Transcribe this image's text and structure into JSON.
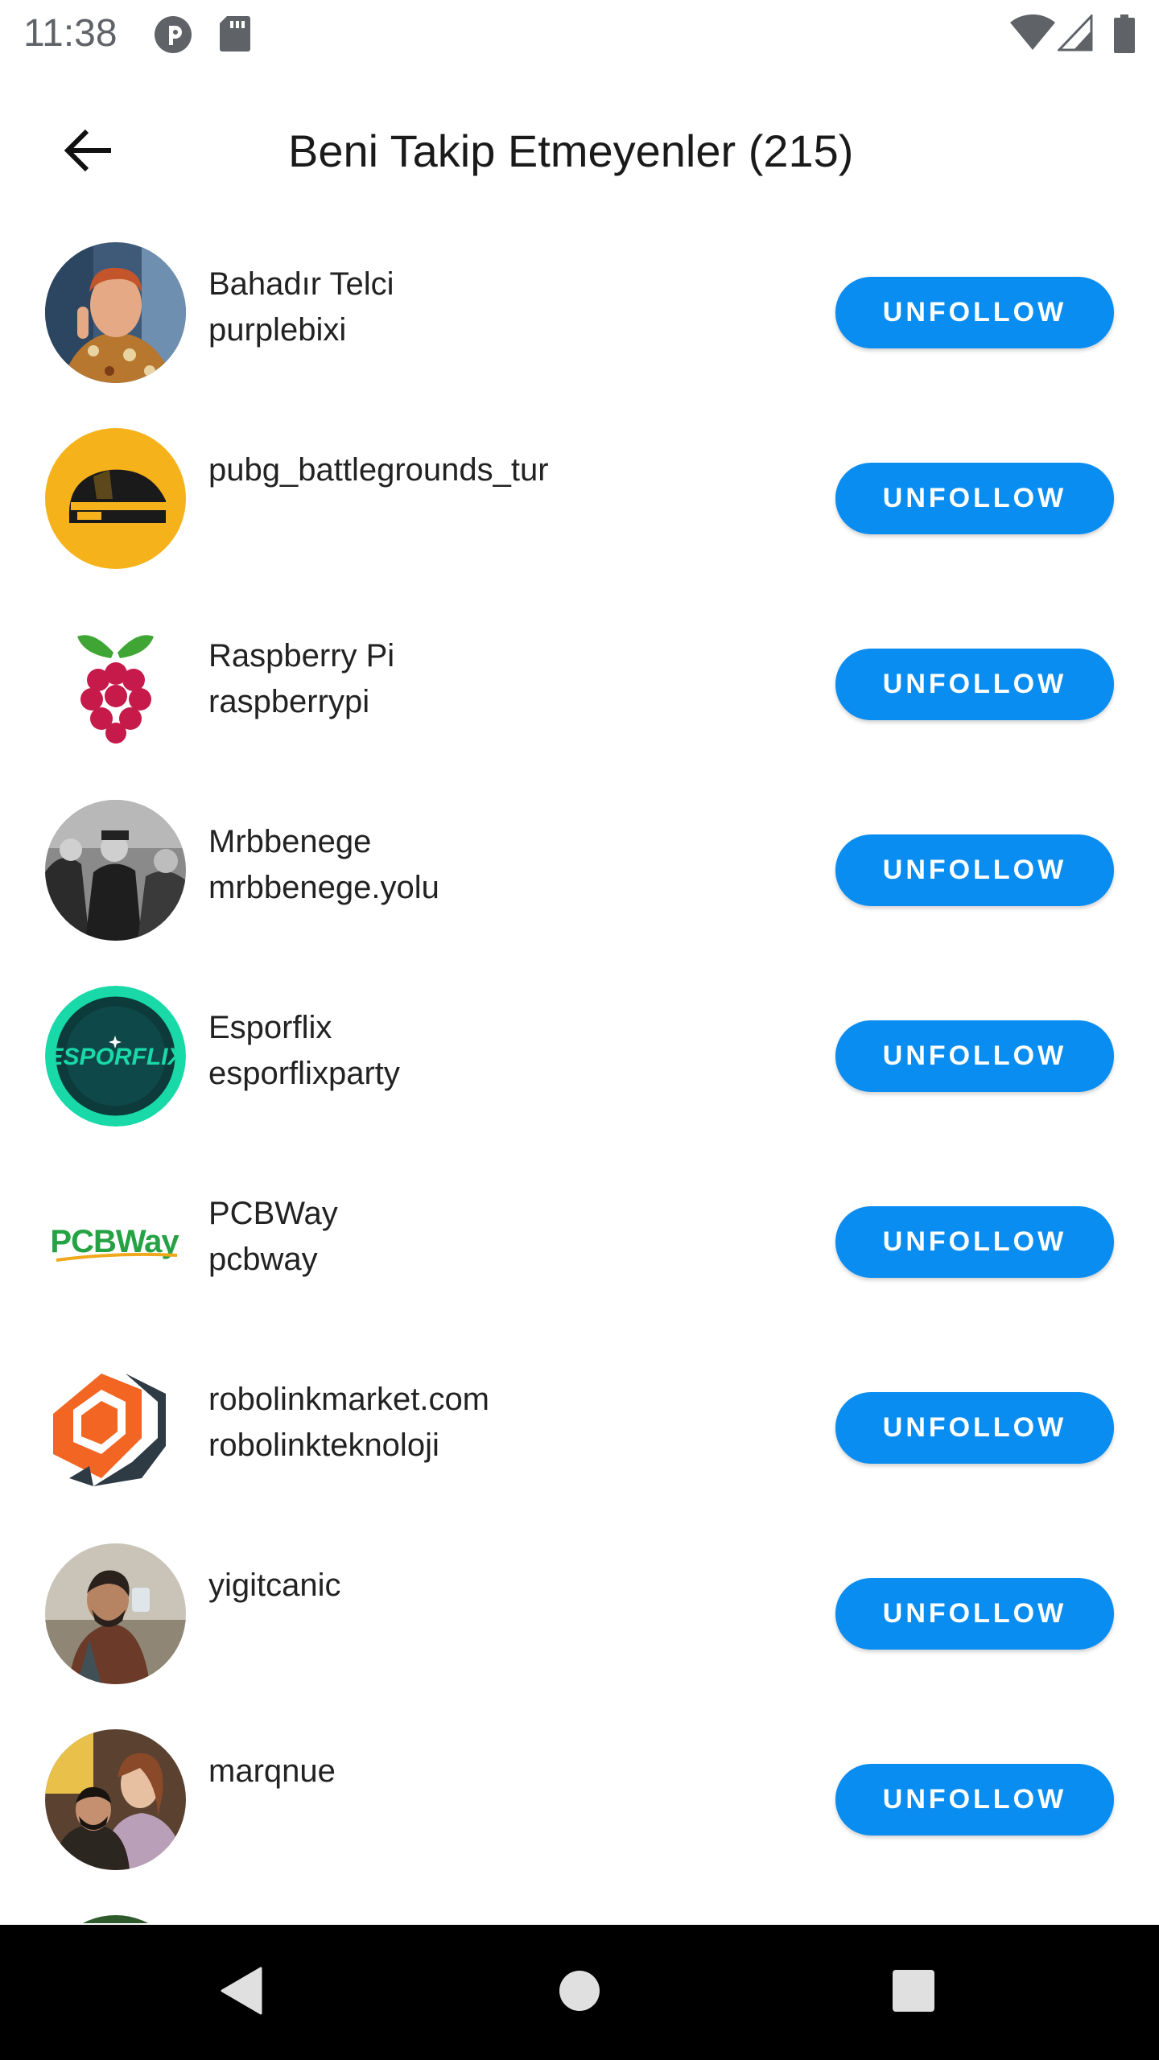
{
  "status_bar": {
    "time": "11:38",
    "icons": [
      "notification-app-icon",
      "sd-card-icon",
      "wifi-icon",
      "cellular-signal-icon",
      "battery-icon"
    ]
  },
  "app_bar": {
    "back_icon": "arrow-left-icon",
    "title": "Beni Takip Etmeyenler (215)"
  },
  "list": {
    "button_label": "UNFOLLOW",
    "button_color": "#0a8df1",
    "items": [
      {
        "name": "Bahadır Telci",
        "username": "purplebixi",
        "avatar": "person-photo"
      },
      {
        "name": "",
        "username": "pubg_battlegrounds_tur",
        "avatar": "pubg-helmet-logo"
      },
      {
        "name": "Raspberry Pi",
        "username": "raspberrypi",
        "avatar": "raspberry-pi-logo"
      },
      {
        "name": "Mrbbenege",
        "username": "mrbbenege.yolu",
        "avatar": "soldiers-photo"
      },
      {
        "name": "Esporflix",
        "username": "esporflixparty",
        "avatar": "esporflix-logo"
      },
      {
        "name": "PCBWay",
        "username": "pcbway",
        "avatar": "pcbway-logo",
        "logo_text": "PCBWay"
      },
      {
        "name": "robolinkmarket.com",
        "username": "robolinkteknoloji",
        "avatar": "robolink-logo"
      },
      {
        "name": "",
        "username": "yigitcanic",
        "avatar": "person-photo"
      },
      {
        "name": "",
        "username": "marqnue",
        "avatar": "couple-photo"
      }
    ]
  },
  "nav_bar": {
    "back": "triangle-back-icon",
    "home": "circle-home-icon",
    "recents": "square-recents-icon"
  }
}
